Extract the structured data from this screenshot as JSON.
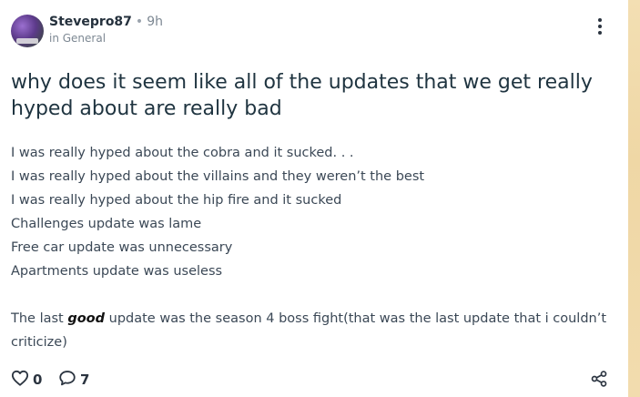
{
  "post": {
    "author": "Stevepro87",
    "separator": "•",
    "time": "9h",
    "category": "in General",
    "title": "why does it seem like all of the updates that we get really hyped about are really bad",
    "lines": [
      "I was really hyped about the cobra and it sucked. . .",
      "I was really hyped about the villains and they weren’t the best",
      "I was really hyped about the hip fire and it sucked",
      "Challenges update was lame",
      "Free car update was unnecessary",
      "Apartments update was useless"
    ],
    "final_paragraph": {
      "before": "The last ",
      "emphasis": "good",
      "after": " update was the season 4 boss fight(that was the last update that i couldn’t criticize)"
    }
  },
  "footer": {
    "likes": "0",
    "comments": "7"
  },
  "icons": {
    "like": "heart-outline-icon",
    "comment": "speech-bubble-icon",
    "share": "share-icon",
    "menu": "more-vertical-icon"
  }
}
